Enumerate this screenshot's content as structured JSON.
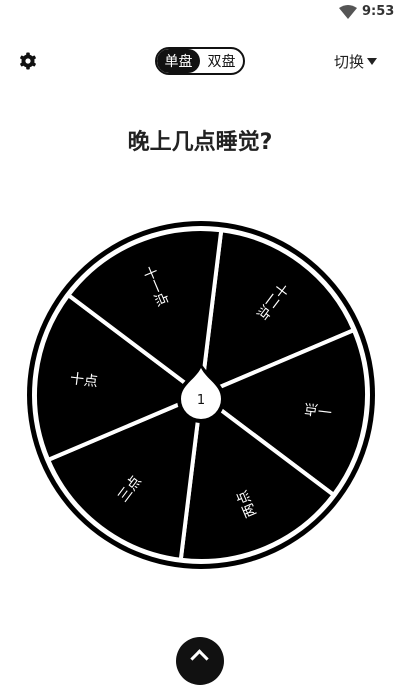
{
  "status_bar": {
    "time": "9:53"
  },
  "header": {
    "mode_tabs": [
      {
        "label": "单盘",
        "active": true
      },
      {
        "label": "双盘",
        "active": false
      }
    ],
    "switch_label": "切换"
  },
  "question": "晚上几点睡觉?",
  "wheel": {
    "center_label": "1",
    "segments": [
      {
        "label": "十二点"
      },
      {
        "label": "一点"
      },
      {
        "label": "两点"
      },
      {
        "label": "三点"
      },
      {
        "label": "十点"
      },
      {
        "label": "十一点"
      }
    ],
    "colors": {
      "segment": "#000000",
      "divider": "#ffffff"
    }
  }
}
